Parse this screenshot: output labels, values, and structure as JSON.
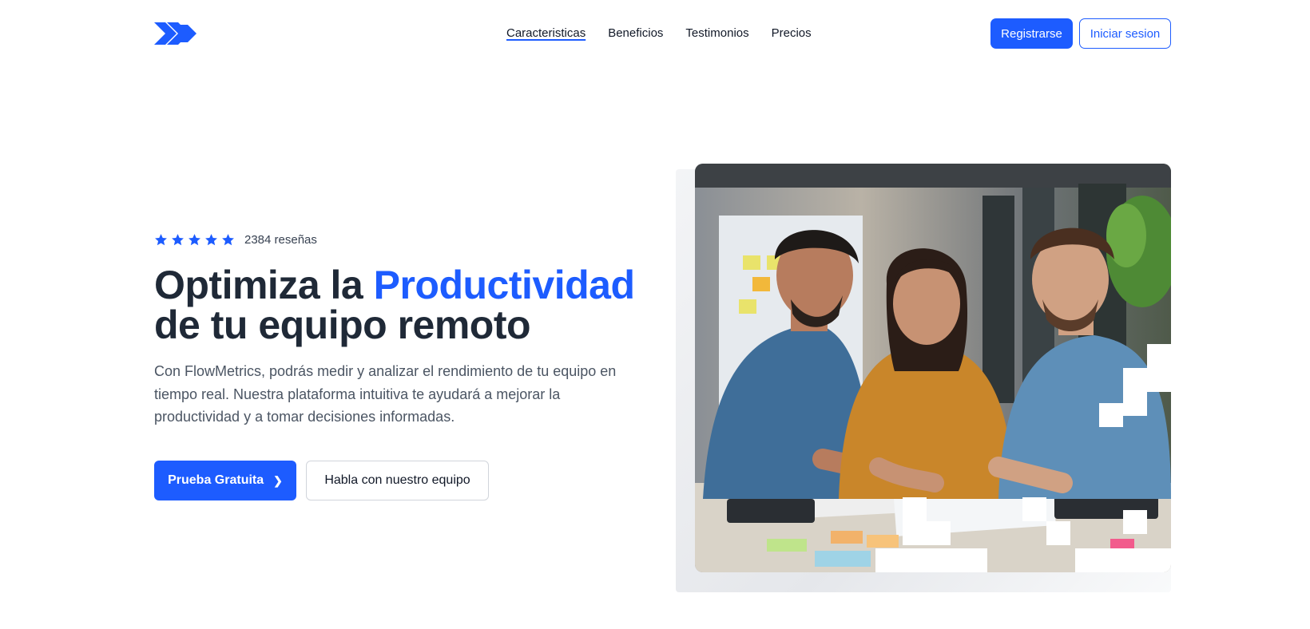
{
  "header": {
    "nav": [
      {
        "label": "Caracteristicas"
      },
      {
        "label": "Beneficios"
      },
      {
        "label": "Testimonios"
      },
      {
        "label": "Precios"
      }
    ],
    "register_label": "Registrarse",
    "login_label": "Iniciar sesion"
  },
  "hero": {
    "rating": {
      "stars": 5,
      "reviews": "2384 reseñas"
    },
    "title_part1": "Optimiza la ",
    "title_accent": "Productividad",
    "title_part2": "de tu equipo remoto",
    "description": "Con FlowMetrics, podrás medir y analizar el rendimiento de tu equipo en tiempo real. Nuestra plataforma intuitiva te ayudará a mejorar la productividad y a tomar decisiones informadas.",
    "primary_cta": "Prueba Gratuita",
    "secondary_cta": "Habla con nuestro equipo"
  },
  "colors": {
    "accent": "#1d5cff",
    "heading": "#1f2937",
    "body_text": "#4b5563"
  },
  "icons": {
    "logo": "double-chevron-right-logo",
    "star": "star-icon",
    "chevron": "chevron-right-icon"
  }
}
